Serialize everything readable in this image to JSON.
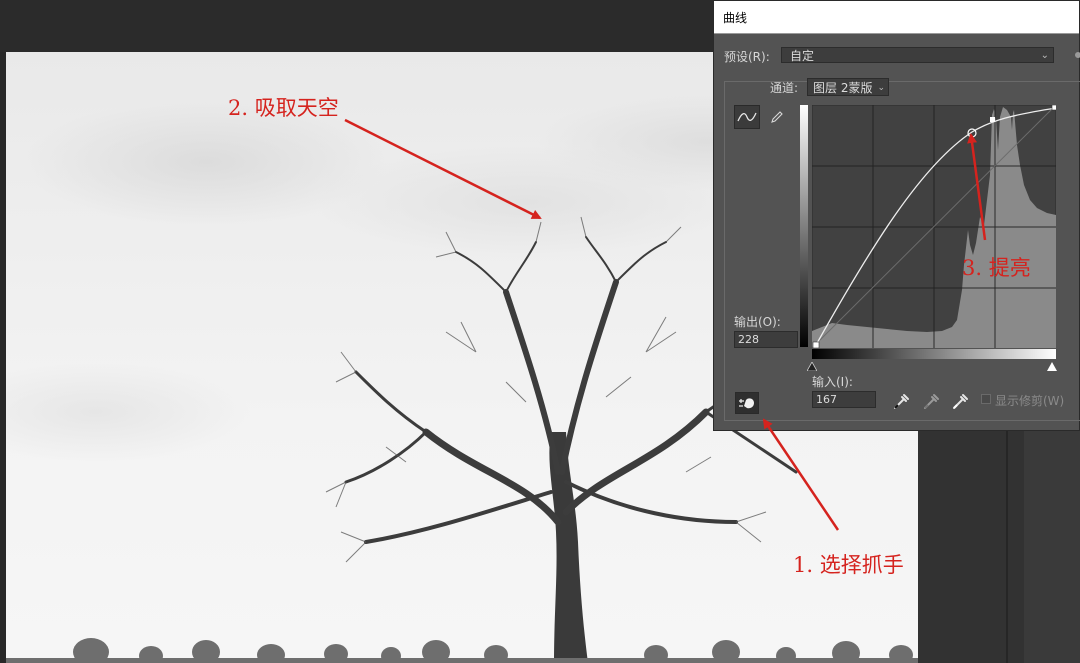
{
  "dialog": {
    "title": "曲线",
    "preset_label": "预设(R):",
    "preset_value": "自定",
    "channel_label": "通道:",
    "channel_value": "图层 2蒙版",
    "output_label": "输出(O):",
    "output_value": "228",
    "input_label": "输入(I):",
    "input_value": "167",
    "show_clipping_label": "显示修剪(W)"
  },
  "annotations": {
    "step1": "1. 选择抓手",
    "step2": "2. 吸取天空",
    "step3": "3. 提亮"
  },
  "colors": {
    "annotation_red": "#d5231e",
    "dialog_bg": "#535353"
  },
  "icons": [
    "curve-point-icon",
    "pencil-icon",
    "target-adjust-hand-icon",
    "black-eyedropper-icon",
    "gray-eyedropper-icon",
    "white-eyedropper-icon"
  ]
}
